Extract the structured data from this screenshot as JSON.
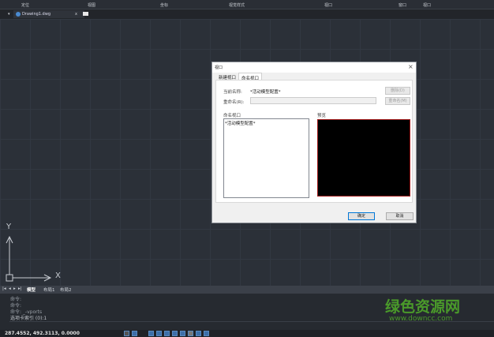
{
  "ribbon": {
    "items": [
      "定位",
      "视图",
      "坐标",
      "视觉样式",
      "视口",
      "窗口",
      "视口"
    ]
  },
  "file_tab": {
    "name": "Drawing1.dwg",
    "close": "x"
  },
  "ucs": {
    "x": "X",
    "y": "Y"
  },
  "dialog": {
    "title": "视口",
    "close": "×",
    "tabs": [
      "新建视口",
      "命名视口"
    ],
    "active_tab": 1,
    "current_name_label": "当前名称:",
    "current_name_value": "*活动模型配置*",
    "rename_label": "重命名(R):",
    "rename_value": "",
    "delete_button": "删除(D)",
    "rename_button": "重命名(M)",
    "named_viewports_label": "命名视口",
    "named_viewports": [
      "*活动模型配置*"
    ],
    "preview_label": "预览",
    "ok": "确定",
    "cancel": "取消"
  },
  "layout_tabs": {
    "nav": [
      "|◂",
      "◂",
      "▸",
      "▸|"
    ],
    "tabs": [
      "模型",
      "布局1",
      "布局2"
    ],
    "active": 0
  },
  "command_history": [
    "命令:",
    "命令:",
    "命令: _-vports",
    "选项卡索引 (0):1"
  ],
  "status": {
    "coordinates": "287.4552, 492.3113, 0.0000"
  },
  "watermark": {
    "title": "绿色资源网",
    "url": "www.downcc.com",
    "color": "#4a9a2a"
  }
}
